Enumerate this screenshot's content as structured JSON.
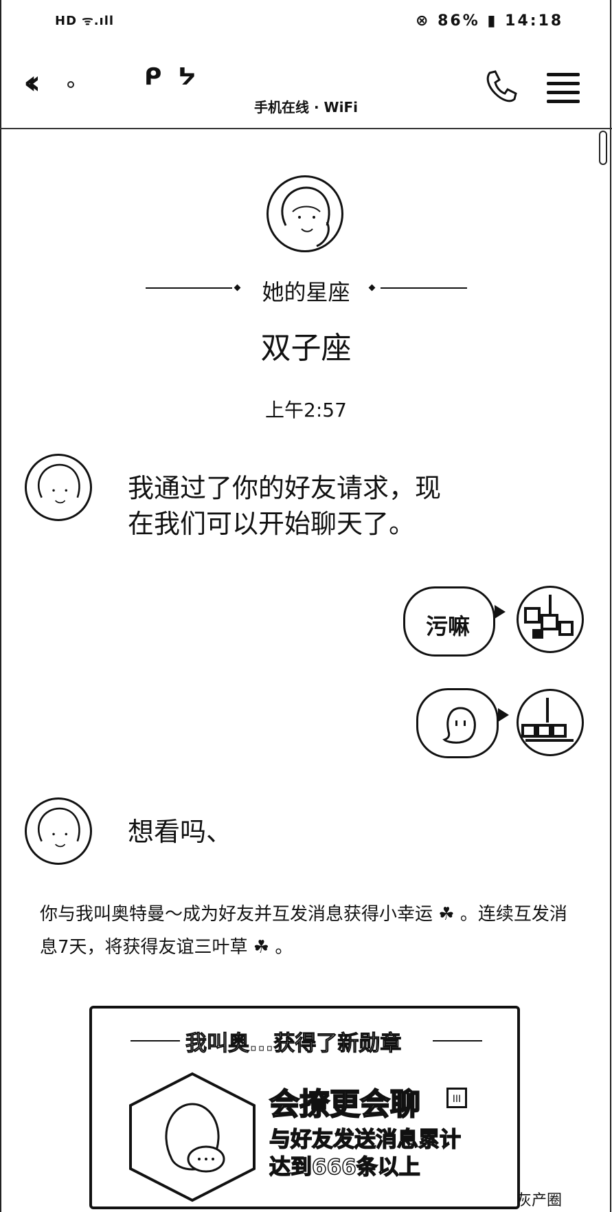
{
  "status_bar": {
    "left": "HD ᯤ.ıll",
    "right": "⊗ 86% ▮ 14:18"
  },
  "header": {
    "back_label": "‹‹",
    "title": "ᑭ ᔭ",
    "subtitle": "手机在线 · WiFi"
  },
  "constellation": {
    "label": "她的星座",
    "value": "双子座"
  },
  "chat": {
    "timestamp": "上午2:57",
    "messages": [
      {
        "from": "her",
        "line1": "我通过了你的好友请求，现",
        "line2": "在我们可以开始聊天了。"
      },
      {
        "from": "me",
        "text": "污嘛"
      },
      {
        "from": "me",
        "type": "emoji"
      },
      {
        "from": "her",
        "text": "想看吗、"
      }
    ]
  },
  "notice": {
    "text": "你与我叫奥特曼～成为好友并互发消息获得小幸运 ☘ 。连续互发消息7天，将获得友谊三叶草 ☘ 。"
  },
  "badge": {
    "header": "我叫奥...获得了新勋章",
    "name": "会撩更会聊",
    "level": "III",
    "desc_line1": "与好友发送消息累计",
    "desc_line2": "达到666条以上"
  },
  "watermark": "灰产圈"
}
